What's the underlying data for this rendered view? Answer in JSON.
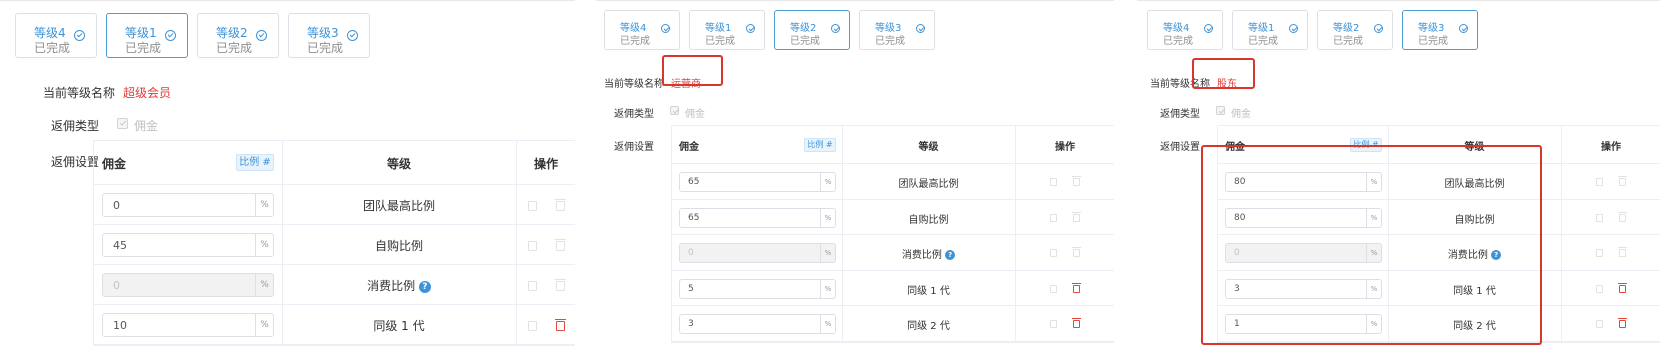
{
  "colors": {
    "accent": "#3d93d8",
    "value_red": "#e23b3b",
    "highlight_box": "#d9362b"
  },
  "panels": [
    {
      "steps": [
        {
          "label": "等级4",
          "status": "已完成"
        },
        {
          "label": "等级1",
          "status": "已完成"
        },
        {
          "label": "等级2",
          "status": "已完成"
        },
        {
          "label": "等级3",
          "status": "已完成"
        }
      ],
      "active_step": 1,
      "level_name_label": "当前等级名称",
      "level_name_value": "超级会员",
      "rebate_type_label": "返佣类型",
      "rebate_type_option": "佣金",
      "rebate_setting_label": "返佣设置",
      "table": {
        "col_commission": "佣金",
        "ratio_tag": "比例 #",
        "col_level": "等级",
        "col_action": "操作",
        "rows": [
          {
            "value": "0",
            "unit": "%",
            "level": "团队最高比例",
            "disabled": false,
            "help": false,
            "delete_active": false
          },
          {
            "value": "45",
            "unit": "%",
            "level": "自购比例",
            "disabled": false,
            "help": false,
            "delete_active": false
          },
          {
            "value": "0",
            "unit": "%",
            "level": "消费比例",
            "disabled": true,
            "help": true,
            "delete_active": false
          },
          {
            "value": "10",
            "unit": "%",
            "level": "同级 1 代",
            "disabled": false,
            "help": false,
            "delete_active": true
          }
        ]
      }
    },
    {
      "steps": [
        {
          "label": "等级4",
          "status": "已完成"
        },
        {
          "label": "等级1",
          "status": "已完成"
        },
        {
          "label": "等级2",
          "status": "已完成"
        },
        {
          "label": "等级3",
          "status": "已完成"
        }
      ],
      "active_step": 2,
      "level_name_label": "当前等级名称",
      "level_name_value": "运营商",
      "rebate_type_label": "返佣类型",
      "rebate_type_option": "佣金",
      "rebate_setting_label": "返佣设置",
      "table": {
        "col_commission": "佣金",
        "ratio_tag": "比例 #",
        "col_level": "等级",
        "col_action": "操作",
        "rows": [
          {
            "value": "65",
            "unit": "%",
            "level": "团队最高比例",
            "disabled": false,
            "help": false,
            "delete_active": false
          },
          {
            "value": "65",
            "unit": "%",
            "level": "自购比例",
            "disabled": false,
            "help": false,
            "delete_active": false
          },
          {
            "value": "0",
            "unit": "%",
            "level": "消费比例",
            "disabled": true,
            "help": true,
            "delete_active": false
          },
          {
            "value": "5",
            "unit": "%",
            "level": "同级 1 代",
            "disabled": false,
            "help": false,
            "delete_active": true
          },
          {
            "value": "3",
            "unit": "%",
            "level": "同级 2 代",
            "disabled": false,
            "help": false,
            "delete_active": true
          }
        ]
      }
    },
    {
      "steps": [
        {
          "label": "等级4",
          "status": "已完成"
        },
        {
          "label": "等级1",
          "status": "已完成"
        },
        {
          "label": "等级2",
          "status": "已完成"
        },
        {
          "label": "等级3",
          "status": "已完成"
        }
      ],
      "active_step": 3,
      "level_name_label": "当前等级名称",
      "level_name_value": "股东",
      "rebate_type_label": "返佣类型",
      "rebate_type_option": "佣金",
      "rebate_setting_label": "返佣设置",
      "table": {
        "col_commission": "佣金",
        "ratio_tag": "比例 #",
        "col_level": "等级",
        "col_action": "操作",
        "rows": [
          {
            "value": "80",
            "unit": "%",
            "level": "团队最高比例",
            "disabled": false,
            "help": false,
            "delete_active": false
          },
          {
            "value": "80",
            "unit": "%",
            "level": "自购比例",
            "disabled": false,
            "help": false,
            "delete_active": false
          },
          {
            "value": "0",
            "unit": "%",
            "level": "消费比例",
            "disabled": true,
            "help": true,
            "delete_active": false
          },
          {
            "value": "3",
            "unit": "%",
            "level": "同级 1 代",
            "disabled": false,
            "help": false,
            "delete_active": true
          },
          {
            "value": "1",
            "unit": "%",
            "level": "同级 2 代",
            "disabled": false,
            "help": false,
            "delete_active": true
          }
        ]
      }
    }
  ]
}
